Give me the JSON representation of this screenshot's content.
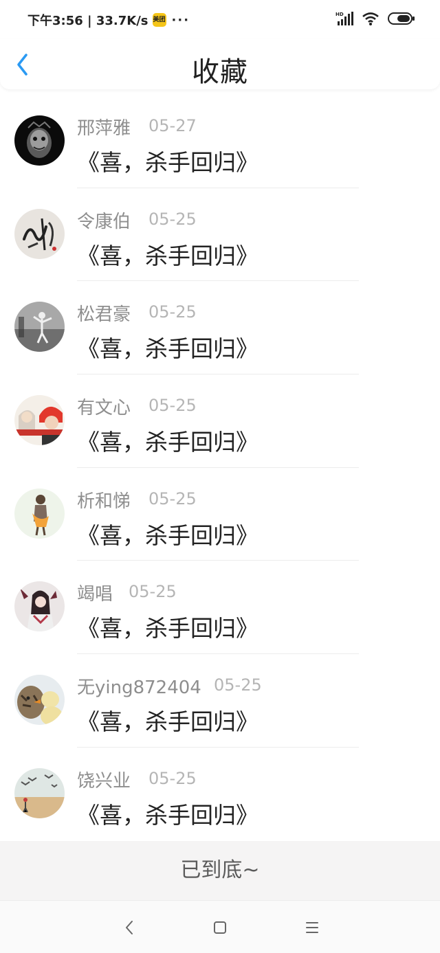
{
  "status": {
    "time_speed": "下午3:56 | 33.7K/s",
    "badge": "美团",
    "dots": "···",
    "battery": "battery-icon",
    "wifi": "wifi-icon",
    "signal": "signal-icon"
  },
  "header": {
    "title": "收藏",
    "accent": "#2b9af3"
  },
  "items": [
    {
      "name": "邢萍雅",
      "date": "05-27",
      "title": "《喜，杀手回归》"
    },
    {
      "name": "令康伯",
      "date": "05-25",
      "title": "《喜，杀手回归》"
    },
    {
      "name": "松君豪",
      "date": "05-25",
      "title": "《喜，杀手回归》"
    },
    {
      "name": "有文心",
      "date": "05-25",
      "title": "《喜，杀手回归》"
    },
    {
      "name": "析和悌",
      "date": "05-25",
      "title": "《喜，杀手回归》"
    },
    {
      "name": "竭唱",
      "date": "05-25",
      "title": "《喜，杀手回归》"
    },
    {
      "name": "无ying872404",
      "date": "05-25",
      "title": "《喜，杀手回归》"
    },
    {
      "name": "饶兴业",
      "date": "05-25",
      "title": "《喜，杀手回归》"
    }
  ],
  "footer": {
    "end_text": "已到底~"
  }
}
